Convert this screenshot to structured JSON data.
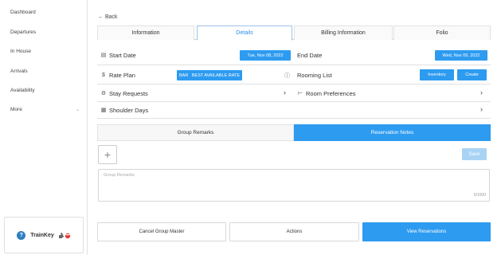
{
  "sidebar": {
    "items": [
      "Dashboard",
      "Departures",
      "In House",
      "Arrivals",
      "Availability",
      "More"
    ],
    "brand": "TrainKey"
  },
  "back_label": "Back",
  "tabs": [
    "Information",
    "Details",
    "Billing Information",
    "Folio"
  ],
  "active_tab": "Details",
  "details": {
    "start_date_label": "Start Date",
    "start_date_value": "Tue, Nov 08, 2022",
    "end_date_label": "End Date",
    "end_date_value": "Wed, Nov 09, 2022",
    "rate_plan_label": "Rate Plan",
    "rate_plan_value": "BAR   BEST AVAILABLE RATE",
    "rooming_list_label": "Rooming List",
    "inventory_label": "Inventory",
    "create_label": "Create",
    "stay_requests_label": "Stay Requests",
    "room_preferences_label": "Room Preferences",
    "shoulder_days_label": "Shoulder Days"
  },
  "remarks": {
    "tabs": [
      "Group Remarks",
      "Reservation Notes"
    ],
    "save_label": "Save",
    "placeholder": "Group Remarks",
    "counter": "0/1000"
  },
  "actions": {
    "cancel_label": "Cancel Group Master",
    "actions_label": "Actions",
    "view_label": "View Reservations"
  },
  "colors": {
    "accent": "#2d9bf0",
    "active_tab_text": "#2d8ce6"
  }
}
